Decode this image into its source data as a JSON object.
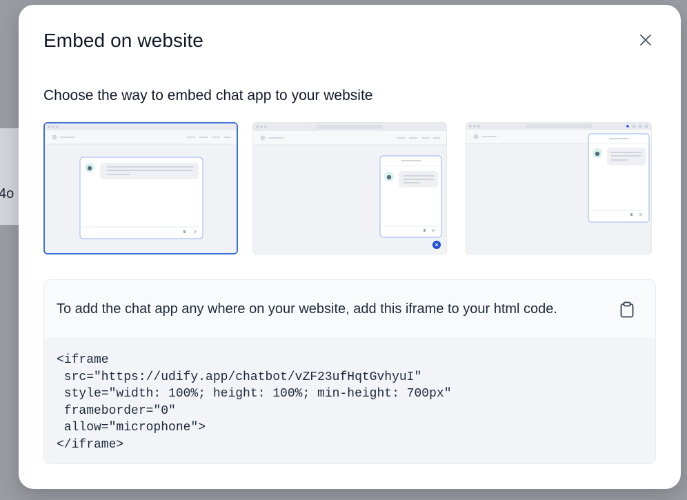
{
  "backdrop": {
    "fragment_text": "4o"
  },
  "modal": {
    "title": "Embed on website",
    "close_icon": "close-icon",
    "subtitle": "Choose the way to embed chat app to your website",
    "options": [
      {
        "name": "iframe-option",
        "selected": true
      },
      {
        "name": "script-bubble-option",
        "selected": false
      },
      {
        "name": "chrome-extension-option",
        "selected": false
      }
    ],
    "code_panel": {
      "description": "To add the chat app any where on your website, add this iframe to your html code.",
      "copy_icon": "clipboard-icon",
      "code": "<iframe\n src=\"https://udify.app/chatbot/vZF23ufHqtGvhyuI\"\n style=\"width: 100%; height: 100%; min-height: 700px\"\n frameborder=\"0\"\n allow=\"microphone\">\n</iframe>"
    }
  },
  "colors": {
    "accent": "#3f6fd8",
    "bubble_button": "#1d4ed8",
    "panel_bg": "#f2f4f7",
    "preview_bg": "#f1f2f6"
  }
}
